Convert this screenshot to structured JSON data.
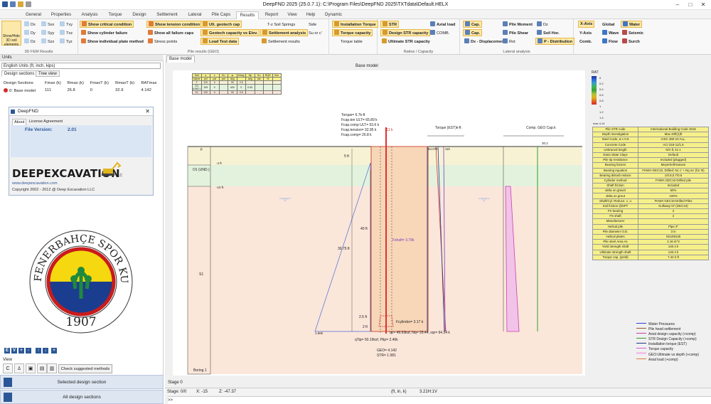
{
  "window": {
    "title": "DeepFND 2025 (25.0.7.1): C:\\Program Files\\DeepFND 2025\\TXTdata\\Default.HELX"
  },
  "ribbon": {
    "tabs": [
      "General",
      "Properties",
      "Analysis",
      "Torque",
      "Design",
      "Settlement",
      "Lateral",
      "Pile Caps",
      "Results",
      "Report",
      "View",
      "Help",
      "Dynamic"
    ],
    "active_tab": "Results",
    "fem": {
      "show_hide": "Show/Hide 3D soil elements",
      "dx": "Dx",
      "dy": "Dy",
      "dz": "Dz",
      "sxx": "Sxx",
      "syy": "Syy",
      "szz": "Szz",
      "txy": "Txy",
      "txz": "Txz",
      "tyz": "Tyz",
      "label": "3D FEM Results"
    },
    "pile_results": {
      "show_critical": "Show critical condition",
      "show_cylinder": "Show cylinder failure",
      "show_individual": "Show individual plate method",
      "show_tension": "Show tension condition",
      "show_all_failure": "Show all failure caps",
      "stress_points": "Stress points",
      "ult_geotech": "Ult. geotech cap",
      "geotech_vs_elev": "Geotech capacity vs Elev.",
      "load_test": "Load Test data",
      "tz_springs": "T-z Soil Springs",
      "settlement_analysis": "Settlement analysis",
      "settlement_results": "Settlement results",
      "label": "Pile results (GEO)"
    },
    "torque": {
      "installation": "Installation Torque",
      "capacity": "Torque capacity",
      "table": "Torque table"
    },
    "ratios": {
      "str": "STR",
      "design_str": "Design STR capacity",
      "ultimate_str": "Ultimate STR capacity",
      "axial_load": "Axial load",
      "comb": "COMB.",
      "label": "Ratios / Capacity"
    },
    "lateral": {
      "cap": "Cap.",
      "cap2": "Cap.",
      "dx_disp": "Dx - Displacement",
      "pile_moment": "Pile Moment",
      "pile_shear": "Pile Shear",
      "rot": "Rot",
      "dz": "Dz",
      "soil_hor": "Soil Hor.",
      "p_dist": "P - Distribution",
      "label": "Lateral analysis"
    },
    "misc": {
      "x_axis": "X-Axis",
      "y_axis": "Y-Axis",
      "comb": "Comb.",
      "global": "Global",
      "wave": "Wave",
      "flow": "Flow",
      "water": "Water",
      "seismic": "Seismic",
      "surch": "Surch"
    },
    "side": "Side",
    "su_or_c": "Su or c'"
  },
  "left": {
    "units_header": "Units",
    "units_value": "English Units (ft, inch, kips)",
    "tabs": [
      "Design sections",
      "Tree view"
    ],
    "table_headers": [
      "Design Sections",
      "Fmax (k)",
      "Rmax (k)",
      "FmaxT (k)",
      "RmaxT (k)",
      "RATmax"
    ],
    "table_row": {
      "name": "0: Base model",
      "fmax": "111",
      "rmax": "26.8",
      "fmaxt": "0",
      "rmaxt": "32.9",
      "ratmax": "4.142"
    },
    "about": {
      "title": "DeepFND",
      "tabs": [
        "About",
        "License Agreement"
      ],
      "file_version_label": "File Version:",
      "file_version": "2.01",
      "logo": "DEEPEXCAVATION",
      "logo_suffix": "LLC",
      "url": "www.deepexcavation.com",
      "copyright": "Copyright 2002 - 2012 @ Deep Excavation LLC"
    },
    "emblem": {
      "text": "FENERBAHÇE SPOR KULÜBÜ",
      "year": "1907"
    },
    "toolbar": [
      "E",
      "V",
      "+",
      "-",
      "↑",
      "↓",
      "+"
    ],
    "view_label": "View",
    "check_suggested": "Check suggested methods",
    "selected_design": "Selected design section",
    "all_design": "All design sections"
  },
  "main": {
    "tab": "Base model",
    "canvas_title": "Base model",
    "soil_table": {
      "rows": [
        [
          "Soil",
          "γ",
          "c",
          "Su",
          "φ",
          "Kavg",
          "δφ",
          "Su",
          "RQD",
          "k/m"
        ],
        [
          "Name",
          "pcf",
          "psf",
          "psf",
          "deg",
          "",
          "deg",
          "ksf",
          "%",
          ""
        ],
        [
          "F",
          "120",
          "0",
          "",
          "30",
          "0.5",
          "",
          "",
          "",
          ""
        ],
        [
          "O1 (UNO.)",
          "105",
          "0",
          "",
          "400",
          "0",
          "0.50",
          "",
          "",
          ""
        ],
        [
          "S1",
          "120",
          "0",
          "",
          "30",
          "0.5",
          "",
          "",
          "",
          ""
        ]
      ]
    },
    "soil_layers": [
      {
        "name": "F",
        "depth": "-4 ft"
      },
      {
        "name": "O1 (UND.)",
        "depth": "-10 ft"
      },
      {
        "name": "S1",
        "depth": ""
      },
      {
        "name": "Boring 1",
        "depth": ""
      }
    ],
    "annotations": {
      "torque": "Torque= 6.7k-ft",
      "fcap_ten": "Fcap.ten ULT= 65.89 k",
      "fcap_comp": "Fcap.comp ULT= 53.6 k",
      "fcap_tension": "Fcap.tension= 32.95 k",
      "fcap_compression": "Fcap.comp= 26.8 k",
      "load": "111 k",
      "five_ft": "5 ft",
      "forty_ft": "40 ft",
      "thirtynine": "39.75 ft",
      "fshaft": "Fshaft= 3.79k",
      "fcylinder": "Fcylinder= 3.17 k",
      "two5ft": "2.5 ft",
      "two_ft": "2 ft",
      "qtip": "qTip= 50.16ksf, Ptip= 2.46k",
      "qc": "qc= 49.93ksf, Nq= 29.44, sqr= 94.34 k",
      "geo": "GEO= 4.142",
      "str": "STR= 1.581",
      "torque_axis": "Torque (EST)k-ft",
      "torque_top": "84.07k",
      "torque_top2": "11k",
      "comp_geo": "Comp. GEO Cap.k",
      "comp_val": "30.2",
      "tip_val": "1.66k"
    },
    "ratio_scale": {
      "title": "RAT",
      "labels": [
        "0",
        "0.2",
        "0.4",
        "0.6",
        "0.8",
        "1",
        "1.2",
        "1.4",
        "max 4.14"
      ]
    },
    "properties": [
      [
        "Pile STR code",
        "International Building Code 2015"
      ],
      [
        "Depth investigation",
        "Max 40ft(1)ft"
      ],
      [
        "Steel Code, ø ≤ 0.5",
        "AISC 360-10 ALL."
      ],
      [
        "Concrete Code",
        "ACI 318-11/1.6"
      ],
      [
        "Unbraced length",
        "N/A ft, kx 1"
      ],
      [
        "Drain State Clays",
        "Default"
      ],
      [
        "Pile tip resistance",
        "Included (plugged)"
      ],
      [
        "Bearing factors",
        "Meyerhof/Hansen"
      ],
      [
        "Bearing equation",
        "FHWA-GEC10, Drilled: Nc c' + Nq σv' (for Φ)"
      ],
      [
        "Bearing disturb reduce",
        "1/0.8,0.7/0.6"
      ],
      [
        "Cylinder method",
        "FHWA GEC10-Drilled pile"
      ],
      [
        "Shaft friction",
        "Included"
      ],
      [
        "delta on gravel",
        "50%"
      ],
      [
        "delta on grout",
        "100%"
      ],
      [
        "Shaft/Cyl. Reduce. c, u",
        "FHWA GEC10-Drilled Piles"
      ],
      [
        "Soil friction @SPT",
        "Kulhawy 07 (GEC10)"
      ],
      [
        "FS bearing",
        "2"
      ],
      [
        "FS shaft",
        "2"
      ],
      [
        "Manufacturer",
        ""
      ],
      [
        "Helical pile",
        "Pipe 3\""
      ],
      [
        "Pile diameter O.D.",
        "3 in"
      ],
      [
        "Helical plates",
        "SS109125"
      ],
      [
        "Pile steel Area As",
        "2.16 in^2"
      ],
      [
        "Yield strength shaft",
        "140.4 k"
      ],
      [
        "Ultimate strength shaft",
        "140.4 k"
      ],
      [
        "Torque cap. (yield)",
        "7.42 k-ft"
      ]
    ],
    "legend": [
      "Water Pressures",
      "Pile head settlement",
      "Axial design capacity (+comp)",
      "STR Design Capacity (+comp)",
      "Installation torque (EST)",
      "Torque capacity",
      "GEO:Ultimate vs depth (+comp)",
      "Axial load (+comp)"
    ],
    "stage_label": "Stage 0",
    "status": {
      "stage": "Stage: 0/0",
      "x": "X: -15",
      "z": "Z: -47.37",
      "units": "(ft, in, k)",
      "version": "3.21H:1V"
    },
    "cmd_prompt": ">>"
  },
  "colors": {
    "accent": "#2b5797",
    "highlight": "#fce8a8",
    "soil_f": "#f8f2d5",
    "soil_o1": "#e3f2dd",
    "soil_s1": "#fbe6da",
    "pile": "#f7d7b8"
  }
}
